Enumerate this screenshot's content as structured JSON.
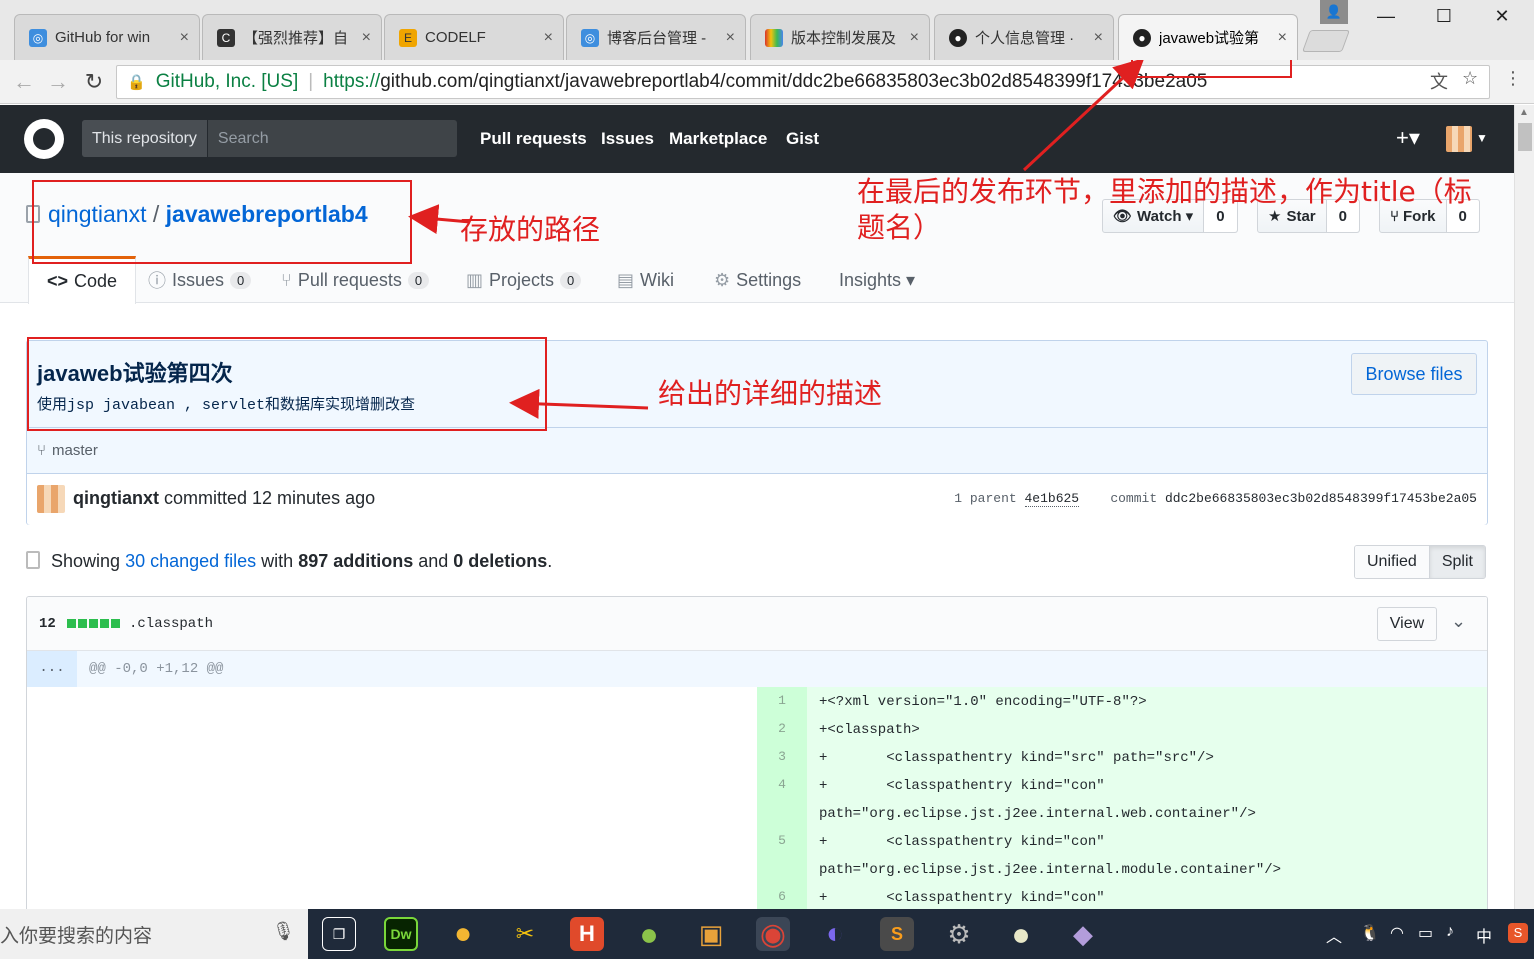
{
  "browser": {
    "tabs": [
      {
        "label": "GitHub for win",
        "icon": "github-desktop-icon",
        "color": "#3e8ede"
      },
      {
        "label": "【强烈推荐】自",
        "icon": "c-logo-icon",
        "color": "#333333"
      },
      {
        "label": "CODELF",
        "icon": "codelf-icon",
        "color": "#f0a500"
      },
      {
        "label": "博客后台管理 -",
        "icon": "github-desktop-icon",
        "color": "#3e8ede"
      },
      {
        "label": "版本控制发展及",
        "icon": "colorful-squares-icon",
        "color": "#d9352c"
      },
      {
        "label": "个人信息管理 ·",
        "icon": "github-icon",
        "color": "#222222"
      },
      {
        "label": "javaweb试验第",
        "icon": "github-icon",
        "color": "#222222"
      }
    ],
    "tab_close": "×",
    "window_controls": {
      "minimize": "—",
      "maximize": "☐",
      "close": "✕"
    },
    "address": {
      "org": "GitHub, Inc. [US]",
      "protocol": "https://",
      "url": "github.com/qingtianxt/javawebreportlab4/commit/ddc2be66835803ec3b02d8548399f17453be2a05"
    }
  },
  "header": {
    "scope": "This repository",
    "search_placeholder": "Search",
    "nav": [
      "Pull requests",
      "Issues",
      "Marketplace",
      "Gist"
    ],
    "plus": "+▾"
  },
  "repo": {
    "owner": "qingtianxt",
    "separator": " / ",
    "name": "javawebreportlab4",
    "watch": {
      "label": "Watch ▾",
      "count": "0"
    },
    "star": {
      "label": "Star",
      "count": "0"
    },
    "fork": {
      "label": "Fork",
      "count": "0"
    },
    "tabs": [
      {
        "label": "Code",
        "icon": "<>"
      },
      {
        "label": "Issues",
        "count": "0",
        "icon": "ⓘ"
      },
      {
        "label": "Pull requests",
        "count": "0",
        "icon": "⑂"
      },
      {
        "label": "Projects",
        "count": "0",
        "icon": "▥"
      },
      {
        "label": "Wiki",
        "icon": "▤"
      },
      {
        "label": "Settings",
        "icon": "⚙"
      },
      {
        "label": "Insights ▾",
        "icon": ""
      }
    ]
  },
  "commit": {
    "title": "javaweb试验第四次",
    "description": "使用jsp javabean , servlet和数据库实现增删改查",
    "browse_files": "Browse files",
    "branch": "master",
    "author": "qingtianxt",
    "committed": " committed 12 minutes ago",
    "parent_label": "1 parent ",
    "parent_sha": "4e1b625",
    "commit_label": "commit ",
    "commit_sha": "ddc2be66835803ec3b02d8548399f17453be2a05"
  },
  "toc": {
    "showing": "Showing ",
    "changed": "30 changed files",
    "with": " with ",
    "additions": "897 additions",
    "and": " and ",
    "deletions": "0 deletions",
    "period": ".",
    "unified": "Unified",
    "split": "Split"
  },
  "file": {
    "count": "12",
    "name": ".classpath",
    "view": "View",
    "hunk_dots": "...",
    "hunk": "@@ -0,0 +1,12 @@",
    "lines": [
      {
        "n": "1",
        "text": "+<?xml version=\"1.0\" encoding=\"UTF-8\"?>"
      },
      {
        "n": "2",
        "text": "+<classpath>"
      },
      {
        "n": "3",
        "text": "+       <classpathentry kind=\"src\" path=\"src\"/>"
      },
      {
        "n": "4",
        "text": "+       <classpathentry kind=\"con\""
      },
      {
        "n": "",
        "text": "path=\"org.eclipse.jst.j2ee.internal.web.container\"/>"
      },
      {
        "n": "5",
        "text": "+       <classpathentry kind=\"con\""
      },
      {
        "n": "",
        "text": "path=\"org.eclipse.jst.j2ee.internal.module.container\"/>"
      },
      {
        "n": "6",
        "text": "+       <classpathentry kind=\"con\""
      }
    ]
  },
  "taskbar": {
    "search_placeholder": "入你要搜索的内容",
    "ime": "中",
    "apps": [
      {
        "name": "task-view-icon",
        "label": "❐",
        "color": "#1f2a3a"
      },
      {
        "name": "dreamweaver-icon",
        "label": "Dw",
        "color": "#072401"
      },
      {
        "name": "app-yellow-icon",
        "label": "●",
        "color": "#f2b632"
      },
      {
        "name": "tools-icon",
        "label": "✂",
        "color": "#1f2a3a"
      },
      {
        "name": "hbuilder-icon",
        "label": "H",
        "color": "#e04a2b"
      },
      {
        "name": "app-green-icon",
        "label": "●",
        "color": "#8bc34a"
      },
      {
        "name": "box-icon",
        "label": "▣",
        "color": "#e8a23a"
      },
      {
        "name": "chrome-icon",
        "label": "◉",
        "color": "#db4437"
      },
      {
        "name": "eclipse-icon",
        "label": "◐",
        "color": "#2c2255"
      },
      {
        "name": "sublime-icon",
        "label": "S",
        "color": "#4a4a4a"
      },
      {
        "name": "gear-app-icon",
        "label": "⚙",
        "color": "#6b6b6b"
      },
      {
        "name": "app-circle-icon",
        "label": "●",
        "color": "#e8e8c8"
      },
      {
        "name": "github-desktop-icon",
        "label": "◆",
        "color": "#6e5494"
      }
    ]
  },
  "annotations": {
    "path": "存放的路径",
    "title": "在最后的发布环节，里添加的描述，作为title（标",
    "title2": "题名）",
    "detail": "给出的详细的描述"
  },
  "colors": {
    "annotation": "#e02020",
    "link": "#0366d6",
    "header_bg": "#24292e",
    "addition": "#2cbe4e"
  }
}
